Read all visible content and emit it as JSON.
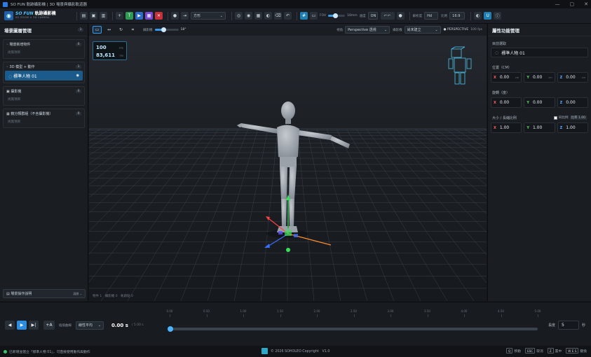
{
  "window": {
    "title": "SO FUN 軌跡攝影機 | 3D 場景與攝影軌道器",
    "controls": [
      "—",
      "▢",
      "✕"
    ]
  },
  "toolbar": {
    "logo_brand": "SO FUN",
    "logo_title": "軌跡攝影機",
    "logo_sub": "SO ZOOM × 3D CAMERA",
    "shape_select": "方形",
    "fov_label": "FOV",
    "fov_value": "18mm",
    "speed_label": "速度",
    "speed_value": "ON",
    "res_label": "解析度",
    "res_value": "Hd",
    "ratio_label": "比例",
    "ratio_value": "16:9",
    "icons": [
      "open-icon",
      "save-icon",
      "export-icon",
      "add-icon",
      "text-icon",
      "play-icon",
      "record-icon",
      "stop-icon",
      "camera-icon",
      "arrow-icon",
      "undo-icon",
      "hash-icon",
      "grid-icon",
      "info-icon"
    ]
  },
  "left": {
    "title": "場景圖層管理",
    "count": "1",
    "groups": [
      {
        "label": "場景新增物件",
        "count": "0",
        "empty": "尚無項目"
      },
      {
        "label": "3D 模型 + 動作",
        "count": "1",
        "items": [
          "標準人物 01"
        ]
      },
      {
        "label": "攝影機",
        "count": "0",
        "empty": "尚無項目"
      },
      {
        "label": "鏡分類群組（不含攝影機）",
        "count": "0",
        "empty": "尚無項目"
      }
    ],
    "help_label": "場景操作說明",
    "help_state": "展開 ⌄"
  },
  "viewport": {
    "slider_label": "攝影機",
    "slider_value": "18°",
    "view_label": "視角",
    "view_value": "Perspective 透視",
    "cam_label": "攝影機",
    "cam_value": "尚未建立",
    "mode_badge": "● PERSPECTIVE",
    "mode_extra": "100 fps",
    "fps": "100",
    "fps_unit": "FPS",
    "tris": "83,611",
    "tris_unit": "TRI",
    "footer": "物件 1　攝影機 0　軌跡點 0"
  },
  "right": {
    "title": "屬性功能管理",
    "target_label": "目前選取",
    "target_name": "標準人物 01",
    "position_label": "位置（CM）",
    "position": {
      "x": "0.00",
      "y": "0.00",
      "z": "0.00",
      "unit": "cm"
    },
    "rotation_label": "旋轉（度）",
    "rotation": {
      "x": "0.00",
      "y": "0.00",
      "z": "0.00"
    },
    "scale_label": "大小 / 長縮比例",
    "lock_label": "同比例",
    "ratio_value": "比率 1.00",
    "scale": {
      "x": "1.00",
      "y": "1.00",
      "z": "1.00"
    }
  },
  "timeline": {
    "ticks": [
      "0.00",
      "0.50",
      "1.00",
      "1.50",
      "2.00",
      "2.50",
      "3.00",
      "3.50",
      "4.00",
      "4.50",
      "5.00"
    ],
    "add_label": "+A",
    "interp_label": "插值曲線",
    "interp_value": "線性平均",
    "time": "0.00 s",
    "total": "/ 5.00 s",
    "speed_label": "長度",
    "speed_value": "5",
    "speed_unit": "秒",
    "progress": 0
  },
  "status": {
    "message": "已新增並建立「標準人物 01」，可直接使用動作與動作",
    "copyright": "© 2026 SOHOLEO Copyright　V1.0",
    "shortcuts": [
      {
        "key": "Q",
        "label": "移動"
      },
      {
        "key": "ESC",
        "label": "取消"
      },
      {
        "key": "Z",
        "label": "置中"
      },
      {
        "key": "W E S",
        "label": "變換"
      }
    ]
  },
  "colors": {
    "accent": "#2d8be0",
    "selected": "#1a5b8c",
    "axis_x": "#ff5c5c",
    "axis_y": "#5cd65c",
    "axis_z": "#5ca8ff"
  }
}
